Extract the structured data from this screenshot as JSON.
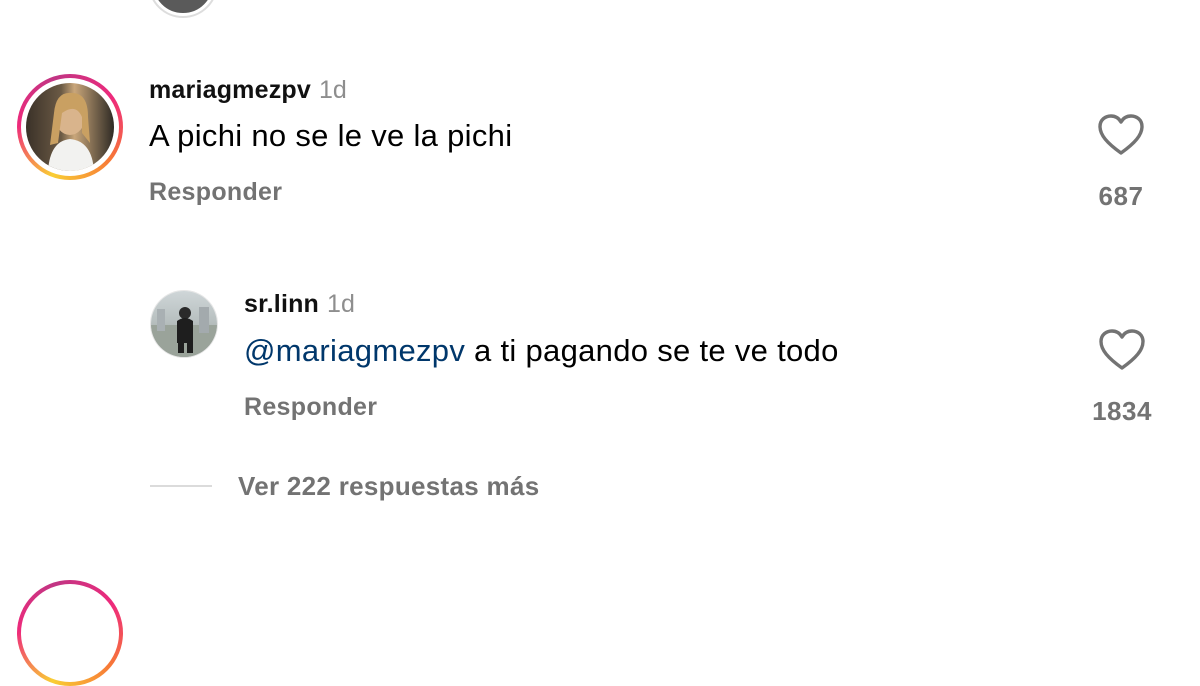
{
  "comments": [
    {
      "username": "mariagmezpv",
      "time": "1d",
      "text": "A pichi no se le ve la pichi",
      "reply_label": "Responder",
      "likes": "687",
      "like_icon": "heart-outline-icon"
    }
  ],
  "replies": [
    {
      "username": "sr.linn",
      "time": "1d",
      "mention": "@mariagmezpv",
      "text": " a ti pagando se te ve todo",
      "reply_label": "Responder",
      "likes": "1834",
      "like_icon": "heart-outline-icon"
    }
  ],
  "view_more": "Ver 222 respuestas más",
  "colors": {
    "mention": "#00376b",
    "secondary_text": "#737373",
    "timestamp": "#8e8e8e",
    "story_ring": [
      "#f9ce34",
      "#ee2a7b",
      "#c13584"
    ]
  }
}
